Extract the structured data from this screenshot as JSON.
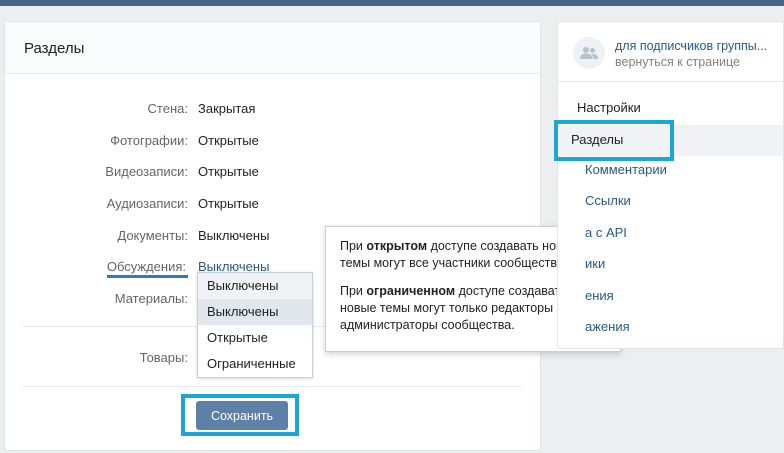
{
  "main": {
    "title": "Разделы",
    "rows": [
      {
        "label": "Стена:",
        "value": "Закрытая"
      },
      {
        "label": "Фотографии:",
        "value": "Открытые"
      },
      {
        "label": "Видеозаписи:",
        "value": "Открытые"
      },
      {
        "label": "Аудиозаписи:",
        "value": "Открытые"
      },
      {
        "label": "Документы:",
        "value": "Выключены"
      },
      {
        "label": "Обсуждения:",
        "value": "Выключены"
      },
      {
        "label": "Материалы:",
        "value": ""
      },
      {
        "label": "Товары:",
        "value": ""
      }
    ],
    "dropdown": {
      "options": [
        "Выключены",
        "Выключены",
        "Открытые",
        "Ограниченные"
      ],
      "selected_index": 1
    },
    "save_label": "Сохранить"
  },
  "tooltip": {
    "p1_pre": "При ",
    "p1_bold": "открытом",
    "p1_post": " доступе создавать новые темы могут все участники сообщества.",
    "p2_pre": "При ",
    "p2_bold": "ограниченном",
    "p2_post": " доступе создавать новые темы могут только редакторы и администраторы сообщества."
  },
  "sidebar": {
    "group_name": "для подписчиков группы...",
    "back_link": "вернуться к странице",
    "heading": "Настройки",
    "active": "Разделы",
    "items": [
      "Комментарии",
      "Ссылки",
      "а с API",
      "ики",
      "ения",
      "ажения"
    ]
  },
  "colors": {
    "accent": "#2a5885",
    "button": "#5d81a8",
    "highlight": "#1aa6d6"
  }
}
